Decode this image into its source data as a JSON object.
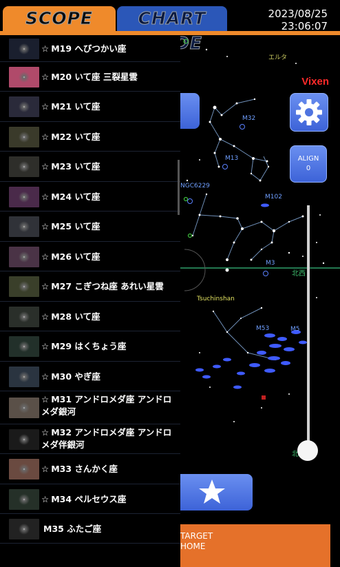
{
  "header": {
    "scope_mode_label": "SCOPE MODE",
    "chart_mode_label": "CHART MODE",
    "date": "2023/08/25",
    "time": "23:06:07",
    "brand": "Vixen"
  },
  "controls": {
    "align_label": "ALIGN",
    "align_value": "0",
    "target_line1": "TARGET",
    "target_line2": "HOME",
    "settings_icon": "gear-icon",
    "favorite_icon": "star-icon"
  },
  "chart_labels": {
    "m32": "M32",
    "m13": "M13",
    "ngc6229": "NGC6229",
    "m102": "M102",
    "m3": "M3",
    "west": "北西",
    "comet": "Tsuchinshan",
    "m53": "M53",
    "m5": "M5",
    "east": "北東",
    "eltanin": "エルタ"
  },
  "objects": [
    {
      "star": "☆",
      "name": "M19 へびつかい座",
      "thumb": "#1a1f2e"
    },
    {
      "star": "☆",
      "name": "M20 いて座 三裂星雲",
      "thumb": "#b04a6a"
    },
    {
      "star": "☆",
      "name": "M21 いて座",
      "thumb": "#2a2a3a"
    },
    {
      "star": "☆",
      "name": "M22 いて座",
      "thumb": "#3a3a2a"
    },
    {
      "star": "☆",
      "name": "M23 いて座",
      "thumb": "#2e2e2a"
    },
    {
      "star": "☆",
      "name": "M24 いて座",
      "thumb": "#4a2a4a"
    },
    {
      "star": "☆",
      "name": "M25 いて座",
      "thumb": "#303238"
    },
    {
      "star": "☆",
      "name": "M26 いて座",
      "thumb": "#4a3346"
    },
    {
      "star": "☆",
      "name": "M27 こぎつね座 あれい星雲",
      "thumb": "#3a3f2a"
    },
    {
      "star": "☆",
      "name": "M28 いて座",
      "thumb": "#2a2f2a"
    },
    {
      "star": "☆",
      "name": "M29 はくちょう座",
      "thumb": "#22302a"
    },
    {
      "star": "☆",
      "name": "M30 やぎ座",
      "thumb": "#2a3440"
    },
    {
      "star": "☆",
      "name": "M31 アンドロメダ座 アンドロメダ銀河",
      "thumb": "#5a5048"
    },
    {
      "star": "☆",
      "name": "M32 アンドロメダ座 アンドロメダ伴銀河",
      "thumb": "#1a1a1a"
    },
    {
      "star": "☆",
      "name": "M33 さんかく座",
      "thumb": "#6a4a40"
    },
    {
      "star": "☆",
      "name": "M34 ペルセウス座",
      "thumb": "#253028"
    },
    {
      "star": "",
      "name": "M35 ふたご座",
      "thumb": "#222"
    }
  ]
}
